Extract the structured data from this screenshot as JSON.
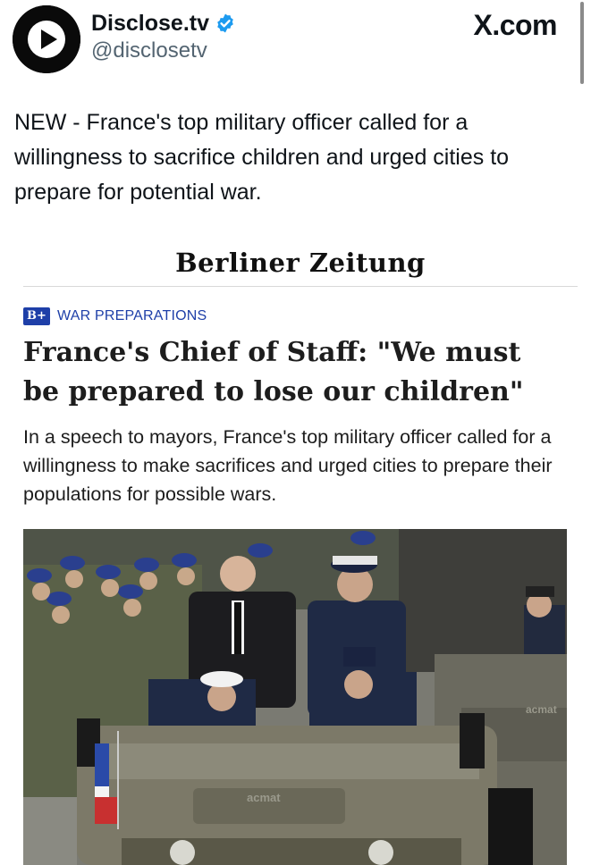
{
  "tweet": {
    "display_name": "Disclose.tv",
    "handle": "@disclosetv",
    "verified": true,
    "source": "X.com",
    "text": "NEW - France's top military officer called for a willingness to sacrifice children and urged cities to prepare for potential war."
  },
  "article": {
    "publication": "Berliner Zeitung",
    "badge": "B+",
    "category": "WAR PREPARATIONS",
    "headline": "France's Chief of Staff: \"We must be prepared to lose our children\"",
    "subheadline": "In a speech to mayors, France's top military officer called for a willingness to make sacrifices and urged cities to prepare their populations for possible wars.",
    "photo": {
      "vehicle_brand": "acmat"
    }
  },
  "colors": {
    "accent_blue": "#1d9bf0",
    "badge_blue": "#1e3fa8",
    "text": "#0f1419",
    "muted": "#536471"
  },
  "icons": {
    "avatar": "play-logo-icon",
    "verified": "verified-badge-icon",
    "masthead": "berlin-bear-icon"
  }
}
